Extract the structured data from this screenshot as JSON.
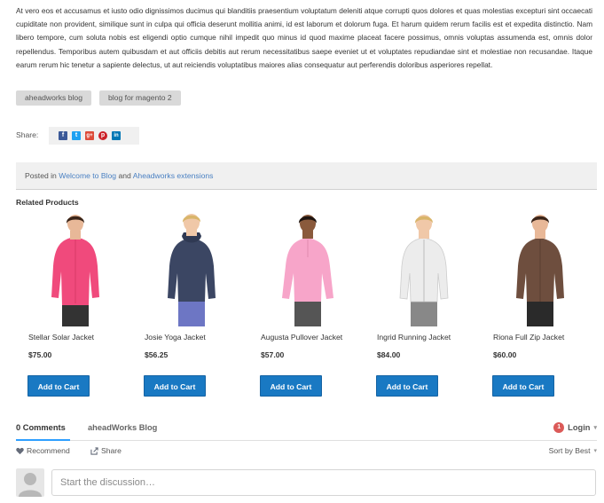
{
  "article": {
    "body": "At vero eos et accusamus et iusto odio dignissimos ducimus qui blanditiis praesentium voluptatum deleniti atque corrupti quos dolores et quas molestias excepturi sint occaecati cupiditate non provident, similique sunt in culpa qui officia deserunt mollitia animi, id est laborum et dolorum fuga. Et harum quidem rerum facilis est et expedita distinctio. Nam libero tempore, cum soluta nobis est eligendi optio cumque nihil impedit quo minus id quod maxime placeat facere possimus, omnis voluptas assumenda est, omnis dolor repellendus. Temporibus autem quibusdam et aut officiis debitis aut rerum necessitatibus saepe eveniet ut et voluptates repudiandae sint et molestiae non recusandae. Itaque earum rerum hic tenetur a sapiente delectus, ut aut reiciendis voluptatibus maiores alias consequatur aut perferendis doloribus asperiores repellat."
  },
  "tags": [
    "aheadworks blog",
    "blog for magento 2"
  ],
  "share": {
    "label": "Share:",
    "icons": [
      {
        "name": "facebook",
        "glyph": "f",
        "color": "#3b5998"
      },
      {
        "name": "twitter",
        "glyph": "t",
        "color": "#1da1f2"
      },
      {
        "name": "google-plus",
        "glyph": "g+",
        "color": "#dd4b39"
      },
      {
        "name": "pinterest",
        "glyph": "p",
        "color": "#cb2027"
      },
      {
        "name": "linkedin",
        "glyph": "in",
        "color": "#0077b5"
      }
    ]
  },
  "posted": {
    "prefix": "Posted in",
    "category1": "Welcome to Blog",
    "conjunction": "and",
    "category2": "Aheadworks extensions"
  },
  "related": {
    "title": "Related Products",
    "add_to_cart_label": "Add to Cart",
    "products": [
      {
        "name": "Stellar Solar Jacket",
        "price": "$75.00",
        "jacket_color": "#f04a7c",
        "pants_color": "#333333"
      },
      {
        "name": "Josie Yoga Jacket",
        "price": "$56.25",
        "jacket_color": "#3b4663",
        "pants_color": "#6d76c4"
      },
      {
        "name": "Augusta Pullover Jacket",
        "price": "$57.00",
        "jacket_color": "#f7a5c9",
        "pants_color": "#555555"
      },
      {
        "name": "Ingrid Running Jacket",
        "price": "$84.00",
        "jacket_color": "#ececec",
        "pants_color": "#888888"
      },
      {
        "name": "Riona Full Zip Jacket",
        "price": "$60.00",
        "jacket_color": "#6e4e3e",
        "pants_color": "#2a2a2a"
      }
    ]
  },
  "comments": {
    "tab_count": "0 Comments",
    "tab_blog": "aheadWorks Blog",
    "notification_count": "1",
    "login": "Login",
    "recommend": "Recommend",
    "share": "Share",
    "sort": "Sort by Best",
    "placeholder": "Start the discussion…"
  }
}
